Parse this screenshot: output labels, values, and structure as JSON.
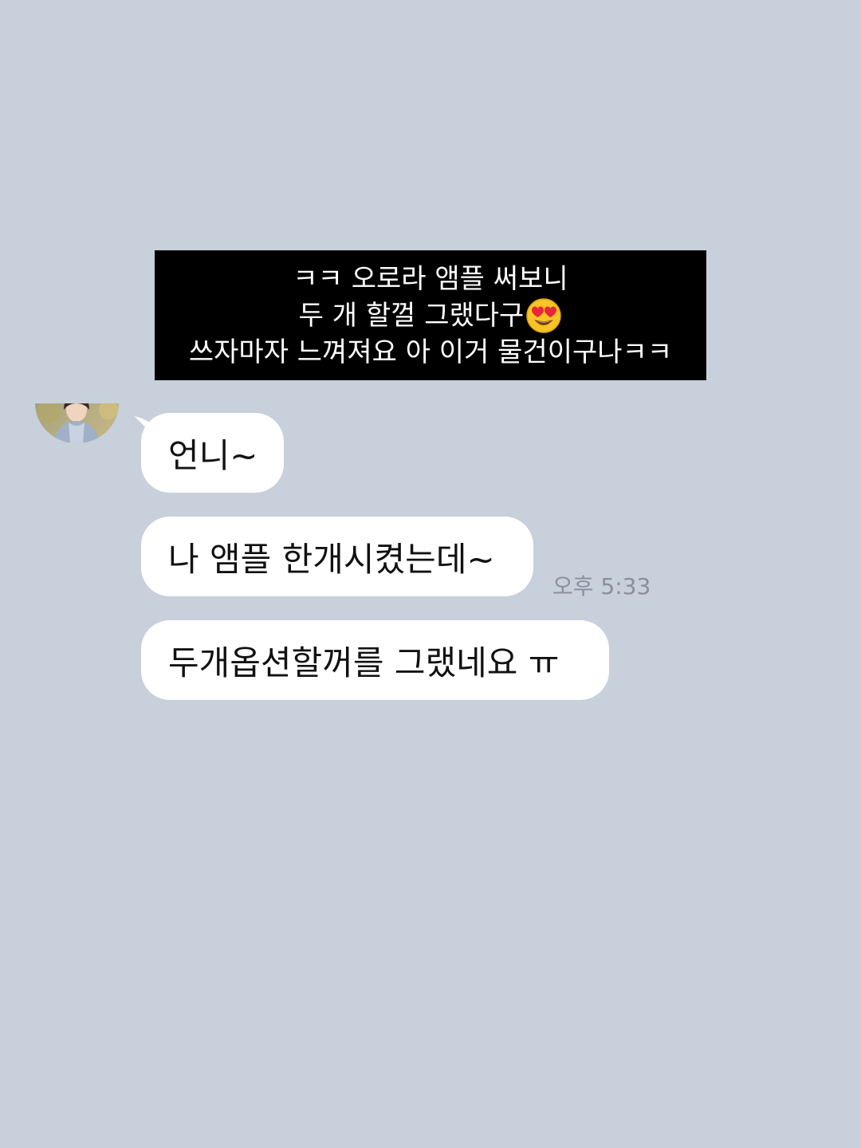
{
  "caption": {
    "line1": "ㅋㅋ 오로라 앰플 써보니",
    "line2": "두 개 할껄 그랬다구",
    "line2_emoji": "heart-eyes-emoji",
    "line3": "쓰자마자 느껴져요 아 이거 물건이구나ㅋㅋ"
  },
  "chat": {
    "messages": [
      {
        "text": "언니~"
      },
      {
        "text": "나 앰플 한개시켰는데~"
      },
      {
        "text": "두개옵션할꺼를 그랬네요 ㅠ"
      }
    ],
    "timestamp": "오후 5:33"
  },
  "colors": {
    "background": "#c8d0dc",
    "bubble": "#ffffff",
    "caption_bg": "#000000",
    "timestamp": "#8a8f98"
  }
}
